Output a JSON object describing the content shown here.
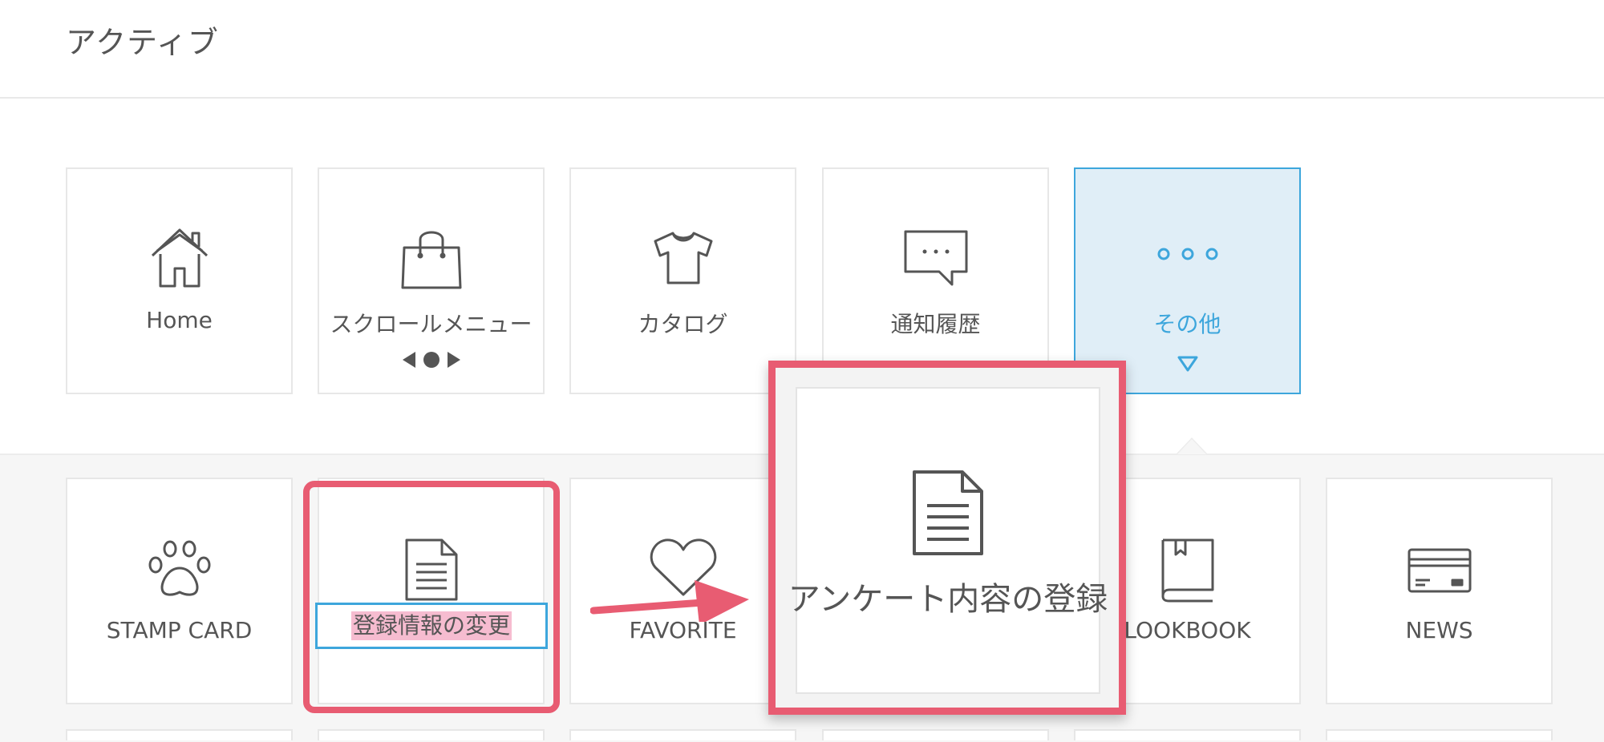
{
  "header": {
    "title": "アクティブ"
  },
  "main_menu": [
    {
      "label": "Home",
      "icon": "home-icon"
    },
    {
      "label": "スクロールメニュー",
      "icon": "shopping-bag-icon",
      "sub_icon": "scroll-indicator-icon"
    },
    {
      "label": "カタログ",
      "icon": "tshirt-icon"
    },
    {
      "label": "通知履歴",
      "icon": "chat-bubble-icon"
    },
    {
      "label": "その他",
      "icon": "more-dots-icon",
      "sub_icon": "triangle-down-icon",
      "state": "active"
    }
  ],
  "sub_menu": [
    {
      "label": "STAMP CARD",
      "icon": "paw-icon"
    },
    {
      "label": "登録情報の変更",
      "icon": "document-icon",
      "state": "editing"
    },
    {
      "label": "FAVORITE",
      "icon": "heart-icon"
    },
    {
      "label": "LOOKBOOK",
      "icon": "book-icon"
    },
    {
      "label": "NEWS",
      "icon": "credit-card-icon"
    }
  ],
  "zoom_callout": {
    "label": "アンケート内容の登録",
    "icon": "document-icon"
  },
  "colors": {
    "accent": "#3da6dc",
    "annotation": "#e85c72",
    "selection": "#f6bcd0",
    "active_bg": "#e0eef7"
  }
}
